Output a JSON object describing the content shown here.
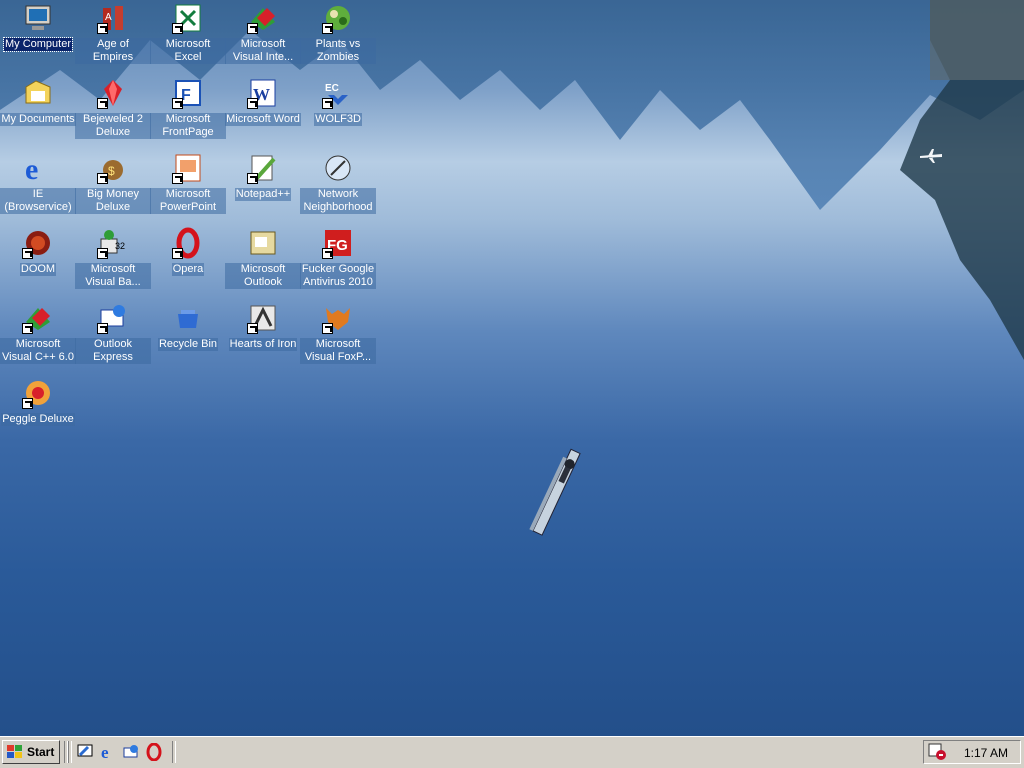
{
  "desktop": {
    "icons": [
      {
        "label": "My Computer",
        "icon": "my-computer-icon"
      },
      {
        "label": "Age of Empires",
        "icon": "age-of-empires-icon"
      },
      {
        "label": "Microsoft Excel",
        "icon": "excel-icon"
      },
      {
        "label": "Microsoft Visual Inte...",
        "icon": "visual-interdev-icon"
      },
      {
        "label": "Plants vs Zombies",
        "icon": "plants-vs-zombies-icon"
      },
      {
        "label": "My Documents",
        "icon": "my-documents-icon"
      },
      {
        "label": "Bejeweled 2 Deluxe",
        "icon": "bejeweled-icon"
      },
      {
        "label": "Microsoft FrontPage",
        "icon": "frontpage-icon"
      },
      {
        "label": "Microsoft Word",
        "icon": "word-icon"
      },
      {
        "label": "WOLF3D",
        "icon": "wolf3d-icon"
      },
      {
        "label": "IE (Browservice)",
        "icon": "internet-explorer-icon"
      },
      {
        "label": "Big Money Deluxe",
        "icon": "big-money-icon"
      },
      {
        "label": "Microsoft PowerPoint",
        "icon": "powerpoint-icon"
      },
      {
        "label": "Notepad++",
        "icon": "notepad-plus-plus-icon"
      },
      {
        "label": "Network Neighborhood",
        "icon": "network-neighborhood-icon"
      },
      {
        "label": "DOOM",
        "icon": "doom-icon"
      },
      {
        "label": "Microsoft Visual Ba...",
        "icon": "visual-basic-icon"
      },
      {
        "label": "Opera",
        "icon": "opera-icon"
      },
      {
        "label": "Microsoft Outlook",
        "icon": "outlook-icon"
      },
      {
        "label": "Fucker Google Antivirus 2010",
        "icon": "antivirus-icon"
      },
      {
        "label": "Microsoft Visual C++ 6.0",
        "icon": "visual-cpp-icon"
      },
      {
        "label": "Outlook Express",
        "icon": "outlook-express-icon"
      },
      {
        "label": "Recycle Bin",
        "icon": "recycle-bin-icon"
      },
      {
        "label": "Hearts of Iron",
        "icon": "hearts-of-iron-icon"
      },
      {
        "label": "Microsoft Visual FoxP...",
        "icon": "visual-foxpro-icon"
      },
      {
        "label": "Peggle Deluxe",
        "icon": "peggle-icon"
      }
    ]
  },
  "taskbar": {
    "start_label": "Start",
    "quick_launch": [
      "show-desktop-icon",
      "internet-explorer-icon",
      "outlook-express-icon",
      "opera-icon"
    ],
    "clock": "1:17 AM",
    "tray_icon": "scheduler-icon"
  },
  "colors": {
    "taskbar": "#d4d0c8",
    "selection": "#0a246a",
    "sky_blue": "#b6cde4",
    "water_blue": "#2a5a99"
  }
}
